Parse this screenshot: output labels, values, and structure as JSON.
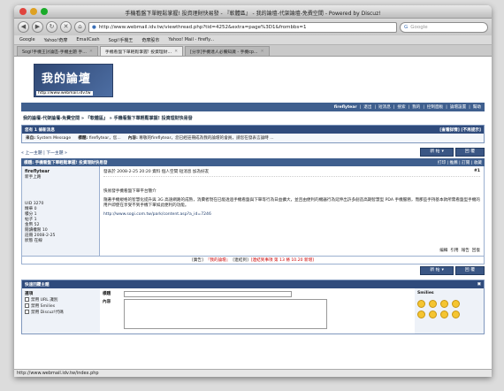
{
  "window": {
    "title": "手機看盤下單輕鬆掌握! 投資理財快易發 - 『軟體區』 - 我的論壇-代架論壇-免費空間 - Powered by Discuz!"
  },
  "toolbar": {
    "url": "http://www.webmail.idv.tw/viewthread.php?tid=4252&extra=page%3D1&frombbs=1",
    "search_placeholder": "Google"
  },
  "bookmarks": [
    "Google",
    "Yahoo!奇摩",
    "EmailCash",
    "Sogi!手機王",
    "奇摩股市",
    "Yahoo! Mail - firefly..."
  ],
  "tabs": [
    {
      "label": "Sogi!手機王討論區-手機主題 手...",
      "active": false
    },
    {
      "label": "手機看盤下單輕鬆掌握! 投資理財...",
      "active": true
    },
    {
      "label": "[分享]手機達人必備知識 - 手機cp...",
      "active": false
    }
  ],
  "header": {
    "logo_text": "我的論壇",
    "logo_url": "http://www.webmail.idv.tw"
  },
  "userbar": {
    "username": "fireflytear",
    "links": [
      "退出",
      "短消息",
      "搜索",
      "我的",
      "控制面板",
      "論壇設置",
      "幫助"
    ]
  },
  "breadcrumb": "我的論壇-代架論壇-免費空間 » 『軟體區』 » 手機看盤下單輕鬆掌握! 投資理財快易發",
  "pm_box": {
    "title": "您有 1 條新消息",
    "actions": "[查看詳情] [不再提示]",
    "from_label": "來自:",
    "from_value": "System Message",
    "subject_label": "標題:",
    "subject_value": "fireflytear，您...",
    "content_label": "內容:",
    "content_value": "尊敬的fireflytear，您已經註冊成為我的論壇的會員，請您在發表言論時 ..."
  },
  "navrow": {
    "prev_next": "« 上一主題 | 下一主題 »",
    "new_button": "新 帖",
    "reply_button": "回 覆"
  },
  "thread": {
    "title": "標題: 手機看盤下單輕鬆掌握! 投資理財快易發",
    "actions": "打印 | 推薦 | 訂閱 | 收藏"
  },
  "post": {
    "author": "fireflytear",
    "rank": "新手上路",
    "meta": "發表於 2008-2-25 20:20  資料  個人空間  短消息  加為好友",
    "number": "#1",
    "stats": [
      "UID 3270",
      "精華 0",
      "積分 1",
      "帖子 1",
      "金幣 52",
      "閱讀權限 10",
      "註冊 2008-2-25",
      "狀態 在線"
    ],
    "body_title": "快易發手機看盤下單平台簡介",
    "body_text": "隨著手機規格的智慧化提升與 3G 高速網路的成熟，消費者現在已能透過手機看盤與下單等行為日益擴大，並且由便利的機器行為延伸出許多創造高期智慧型 PDA 手機服務，而那些手持基本款所需看盤型手機的用戶即使在享受不到手機下單如此便利的功能。",
    "body_link": "http://www.sogi.com.tw/park/content.asp?a_id=7246",
    "footer": [
      "編輯",
      "引用",
      "報告",
      "回復"
    ]
  },
  "adrow": {
    "prefix": "[廣告]",
    "red_text": "『我的論壇』",
    "middle": "[連結到]",
    "suffix": "[連結到事項 第 13 條 10.20 新增]"
  },
  "quickreply": {
    "title": "快速回覆主題",
    "options_label": "選項",
    "options": [
      "禁用 URL 識別",
      "禁用 Smilies",
      "禁用 Discuz!代碼"
    ],
    "subject_label": "標題",
    "content_label": "內容",
    "smilies_label": "Smilies"
  },
  "statusbar": "http://www.webmail.idv.tw/index.php"
}
